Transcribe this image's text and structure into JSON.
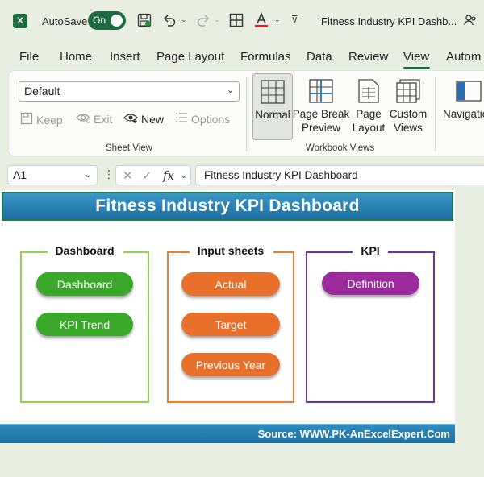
{
  "titlebar": {
    "app_icon": "excel-logo",
    "app_letter": "X",
    "autosave_label": "AutoSave",
    "autosave_state": "On",
    "doc_title": "Fitness Industry KPI Dashb...",
    "icons": [
      "save-icon",
      "undo-icon",
      "redo-icon",
      "table-icon",
      "font-color-icon",
      "customize-toolbar-icon",
      "share-people-icon"
    ]
  },
  "tabs": [
    {
      "label": "File"
    },
    {
      "label": "Home"
    },
    {
      "label": "Insert"
    },
    {
      "label": "Page Layout"
    },
    {
      "label": "Formulas"
    },
    {
      "label": "Data"
    },
    {
      "label": "Review"
    },
    {
      "label": "View",
      "active": true
    },
    {
      "label": "Autom"
    }
  ],
  "ribbon": {
    "sheet_view": {
      "select_value": "Default",
      "keep_label": "Keep",
      "exit_label": "Exit",
      "new_label": "New",
      "options_label": "Options",
      "group_label": "Sheet View"
    },
    "workbook_views": {
      "normal_label": "Normal",
      "page_break_label_1": "Page Break",
      "page_break_label_2": "Preview",
      "page_layout_label_1": "Page",
      "page_layout_label_2": "Layout",
      "custom_views_label_1": "Custom",
      "custom_views_label_2": "Views",
      "group_label": "Workbook Views"
    },
    "navigation_label": "Navigatio"
  },
  "formula_bar": {
    "name_box": "A1",
    "formula": "Fitness Industry KPI Dashboard",
    "fx_label": "fx"
  },
  "sheet": {
    "title": "Fitness Industry KPI Dashboard",
    "source": "Source: WWW.PK-AnExcelExpert.Com",
    "panels": {
      "dashboard": {
        "title": "Dashboard",
        "color": "#92d050",
        "buttons": [
          "Dashboard",
          "KPI Trend"
        ],
        "button_color": "#3aa829"
      },
      "input_sheets": {
        "title": "Input sheets",
        "color": "#ed7d31",
        "buttons": [
          "Actual",
          "Target",
          "Previous Year"
        ],
        "button_color": "#e9702a"
      },
      "kpi": {
        "title": "KPI",
        "color": "#7030a0",
        "buttons": [
          "Definition"
        ],
        "button_color": "#9b2b9c"
      }
    }
  }
}
